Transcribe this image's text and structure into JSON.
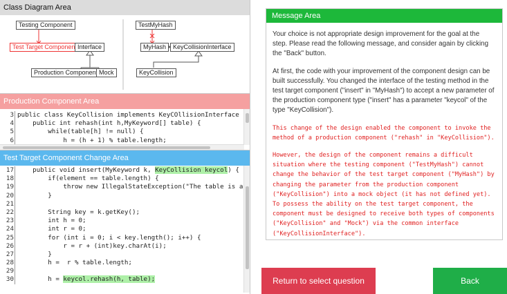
{
  "class_diagram": {
    "title": "Class Diagram Area",
    "boxes": {
      "testing_component": "Testing Component",
      "test_target_component": "Test Target Component",
      "interface": "Interface",
      "production_component": "Production Component",
      "mock": "Mock",
      "test_my_hash": "TestMyHash",
      "my_hash": "MyHash",
      "key_collision_interface": "KeyCollisionInterface",
      "key_collision": "KeyCollision"
    }
  },
  "production_area": {
    "title": "Production Component Area",
    "lines": [
      {
        "num": "3",
        "text": "public class KeyCollision implements KeyCOllisionInterface {"
      },
      {
        "num": "4",
        "text": "    public int rehash(int h,MyKeyword[] table) {"
      },
      {
        "num": "5",
        "text": "        while(table[h] != null) {"
      },
      {
        "num": "6",
        "text": "            h = (h + 1) % table.length;"
      }
    ]
  },
  "test_target_area": {
    "title": "Test Target Component Change Area",
    "lines": [
      {
        "num": "17",
        "pre": "    public void insert(MyKeyword k, ",
        "hl": "KeyCollision keycol",
        "post": ") {"
      },
      {
        "num": "18",
        "pre": "        if(element == table.length) {",
        "hl": "",
        "post": ""
      },
      {
        "num": "19",
        "pre": "            throw new IllegalStateException(\"The table is already f",
        "hl": "",
        "post": ""
      },
      {
        "num": "20",
        "pre": "        }",
        "hl": "",
        "post": ""
      },
      {
        "num": "21",
        "pre": "",
        "hl": "",
        "post": ""
      },
      {
        "num": "22",
        "pre": "        String key = k.getKey();",
        "hl": "",
        "post": ""
      },
      {
        "num": "23",
        "pre": "        int h = 0;",
        "hl": "",
        "post": ""
      },
      {
        "num": "24",
        "pre": "        int r = 0;",
        "hl": "",
        "post": ""
      },
      {
        "num": "25",
        "pre": "        for (int i = 0; i < key.length(); i++) {",
        "hl": "",
        "post": ""
      },
      {
        "num": "26",
        "pre": "            r = r + (int)key.charAt(i);",
        "hl": "",
        "post": ""
      },
      {
        "num": "27",
        "pre": "        }",
        "hl": "",
        "post": ""
      },
      {
        "num": "28",
        "pre": "        h =  r % table.length;",
        "hl": "",
        "post": ""
      },
      {
        "num": "29",
        "pre": "",
        "hl": "",
        "post": ""
      },
      {
        "num": "30",
        "pre": "        h = ",
        "hl": "keycol.rehash(h, table);",
        "post": ""
      }
    ]
  },
  "message_area": {
    "title": "Message Area",
    "paragraph_1": "Your choice is not appropriate design improvement for the goal at the step. Please read the following message, and consider again by clicking the \"Back\" button.",
    "paragraph_2": "At first, the code with your improvement of the component design can be built successfully. You changed the interface of the testing method in the test target component (\"insert\" in \"MyHash\") to accept a new parameter of the production component type (\"insert\" has a parameter \"keycol\" of the type \"KeyCollision\").",
    "code_paragraph_1": "This change of the design enabled the component to invoke the method of a production component (\"rehash\" in \"KeyCollision\").",
    "code_paragraph_2": "However, the design of the component remains a difficult situation where the testing component (\"TestMyHash\") cannot change the behavior of the test target component (\"MyHash\") by changing the parameter from the production component (\"KeyCollision\") into a mock object (it has not defined yet). To possess the ability on the test target component, the component must be designed to receive both types of components (\"KeyCollision\" and \"Mock\") via the common interface (\"KeyCollisionInterface\")."
  },
  "buttons": {
    "return_label": "Return to select question",
    "back_label": "Back"
  },
  "colors": {
    "message_header": "#1db83a",
    "production_header": "#f5a0a0",
    "test_target_header": "#5bb8ee",
    "return_button": "#dd3d50",
    "back_button": "#1fae48",
    "highlight": "#aef0a8",
    "message_code": "#e02020"
  }
}
